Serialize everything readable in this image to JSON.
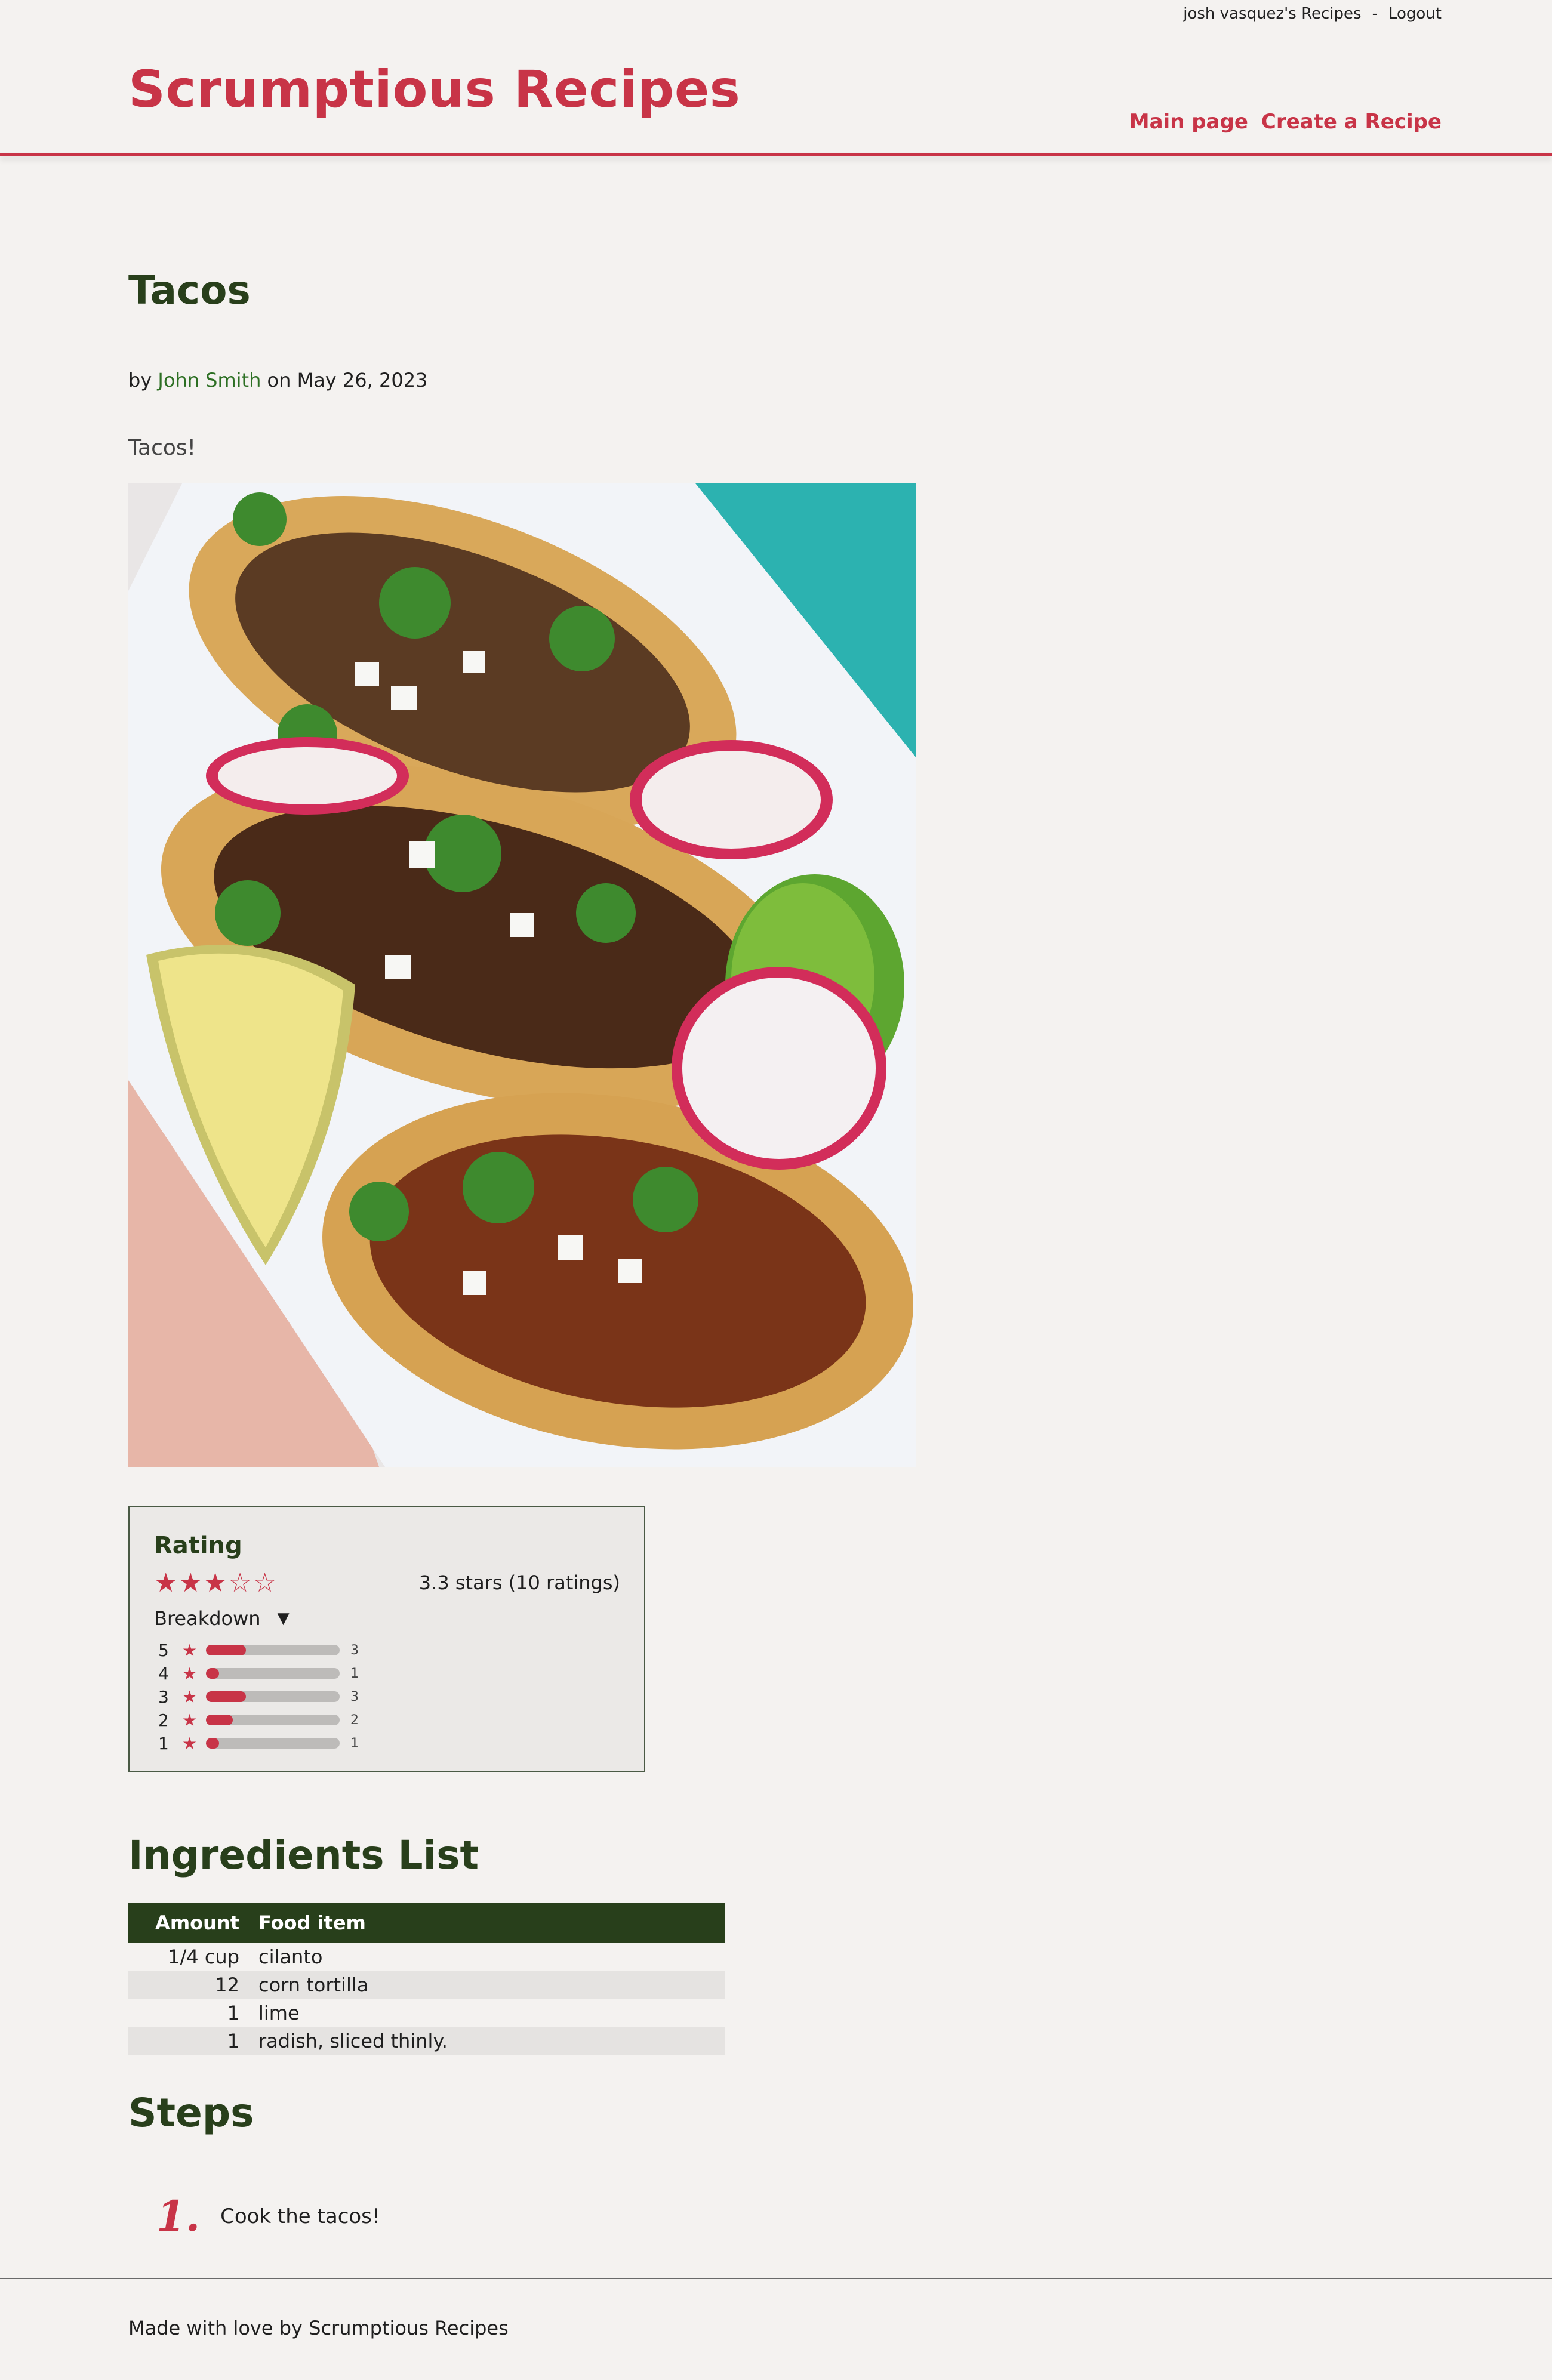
{
  "topbar": {
    "user_link": "josh vasquez's Recipes",
    "separator": "-",
    "logout": "Logout"
  },
  "site": {
    "title": "Scrumptious Recipes"
  },
  "nav": {
    "main_page": "Main page",
    "create_recipe": "Create a Recipe"
  },
  "recipe": {
    "title": "Tacos",
    "by_prefix": "by",
    "author": "John Smith",
    "date_prefix": "on",
    "date": "May 26, 2023",
    "description": "Tacos!"
  },
  "rating": {
    "heading": "Rating",
    "average_stars": 3.3,
    "summary": "3.3 stars (10 ratings)",
    "breakdown_label": "Breakdown",
    "breakdown_toggle_icon": "triangle-down-icon",
    "breakdown": [
      {
        "stars": "5",
        "count": "3",
        "fraction": 0.3
      },
      {
        "stars": "4",
        "count": "1",
        "fraction": 0.1
      },
      {
        "stars": "3",
        "count": "3",
        "fraction": 0.3
      },
      {
        "stars": "2",
        "count": "2",
        "fraction": 0.2
      },
      {
        "stars": "1",
        "count": "1",
        "fraction": 0.1
      }
    ]
  },
  "ingredients": {
    "heading": "Ingredients List",
    "columns": {
      "amount": "Amount",
      "food_item": "Food item"
    },
    "rows": [
      {
        "amount": "1/4 cup",
        "item": "cilanto"
      },
      {
        "amount": "12",
        "item": "corn tortilla"
      },
      {
        "amount": "1",
        "item": "lime"
      },
      {
        "amount": "1",
        "item": "radish, sliced thinly."
      }
    ]
  },
  "steps": {
    "heading": "Steps",
    "items": [
      {
        "number": "1.",
        "text": "Cook the tacos!"
      }
    ]
  },
  "footer": {
    "text": "Made with love by Scrumptious Recipes"
  },
  "colors": {
    "brand": "#c83447",
    "heading_green": "#283f1b",
    "author_green": "#2c6f23",
    "background": "#f4f2f0"
  }
}
